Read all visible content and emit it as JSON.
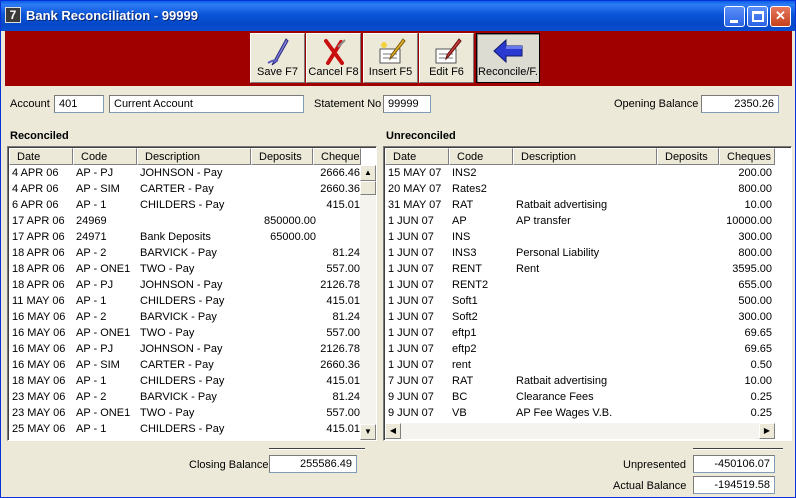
{
  "window": {
    "title": "Bank Reconciliation - 99999",
    "app_icon_text": "7",
    "accent_color": "#a00000"
  },
  "toolbar": {
    "save_label": "Save F7",
    "cancel_label": "Cancel F8",
    "insert_label": "Insert F5",
    "edit_label": "Edit F6",
    "reconcile_label": "Reconcile/F."
  },
  "header": {
    "account_label": "Account",
    "account_code": "401",
    "account_name": "Current Account",
    "statement_label": "Statement No",
    "statement_no": "99999",
    "opening_label": "Opening Balance",
    "opening_balance": "2350.26"
  },
  "reconciled": {
    "title": "Reconciled",
    "columns": [
      "Date",
      "Code",
      "Description",
      "Deposits",
      "Cheques"
    ],
    "rows": [
      [
        "4 APR 06",
        "AP - PJ",
        "JOHNSON - Pay",
        "",
        "2666.46"
      ],
      [
        "4 APR 06",
        "AP - SIM",
        "CARTER - Pay",
        "",
        "2660.36"
      ],
      [
        "6 APR 06",
        "AP - 1",
        "CHILDERS - Pay",
        "",
        "415.01"
      ],
      [
        "17 APR 06",
        "24969",
        "",
        "850000.00",
        ""
      ],
      [
        "17 APR 06",
        "24971",
        "Bank Deposits",
        "65000.00",
        ""
      ],
      [
        "18 APR 06",
        "AP - 2",
        "BARVICK - Pay",
        "",
        "81.24"
      ],
      [
        "18 APR 06",
        "AP - ONE1",
        "TWO - Pay",
        "",
        "557.00"
      ],
      [
        "18 APR 06",
        "AP - PJ",
        "JOHNSON - Pay",
        "",
        "2126.78"
      ],
      [
        "11 MAY 06",
        "AP - 1",
        "CHILDERS - Pay",
        "",
        "415.01"
      ],
      [
        "16 MAY 06",
        "AP - 2",
        "BARVICK - Pay",
        "",
        "81.24"
      ],
      [
        "16 MAY 06",
        "AP - ONE1",
        "TWO - Pay",
        "",
        "557.00"
      ],
      [
        "16 MAY 06",
        "AP - PJ",
        "JOHNSON - Pay",
        "",
        "2126.78"
      ],
      [
        "16 MAY 06",
        "AP - SIM",
        "CARTER - Pay",
        "",
        "2660.36"
      ],
      [
        "18 MAY 06",
        "AP - 1",
        "CHILDERS - Pay",
        "",
        "415.01"
      ],
      [
        "23 MAY 06",
        "AP - 2",
        "BARVICK - Pay",
        "",
        "81.24"
      ],
      [
        "23 MAY 06",
        "AP - ONE1",
        "TWO - Pay",
        "",
        "557.00"
      ],
      [
        "25 MAY 06",
        "AP - 1",
        "CHILDERS - Pay",
        "",
        "415.01"
      ]
    ],
    "closing_label": "Closing Balance",
    "closing_balance": "255586.49"
  },
  "unreconciled": {
    "title": "Unreconciled",
    "columns": [
      "Date",
      "Code",
      "Description",
      "Deposits",
      "Cheques"
    ],
    "rows": [
      [
        "15 MAY 07",
        "INS2",
        "",
        "",
        "200.00"
      ],
      [
        "20 MAY 07",
        "Rates2",
        "",
        "",
        "800.00"
      ],
      [
        "31 MAY 07",
        "RAT",
        "Ratbait advertising",
        "",
        "10.00"
      ],
      [
        "1 JUN 07",
        "AP",
        "AP transfer",
        "",
        "10000.00"
      ],
      [
        "1 JUN 07",
        "INS",
        "",
        "",
        "300.00"
      ],
      [
        "1 JUN 07",
        "INS3",
        "Personal Liability",
        "",
        "800.00"
      ],
      [
        "1 JUN 07",
        "RENT",
        "Rent",
        "",
        "3595.00"
      ],
      [
        "1 JUN 07",
        "RENT2",
        "",
        "",
        "655.00"
      ],
      [
        "1 JUN 07",
        "Soft1",
        "",
        "",
        "500.00"
      ],
      [
        "1 JUN 07",
        "Soft2",
        "",
        "",
        "300.00"
      ],
      [
        "1 JUN 07",
        "eftp1",
        "",
        "",
        "69.65"
      ],
      [
        "1 JUN 07",
        "eftp2",
        "",
        "",
        "69.65"
      ],
      [
        "1 JUN 07",
        "rent",
        "",
        "",
        "0.50"
      ],
      [
        "7 JUN 07",
        "RAT",
        "Ratbait advertising",
        "",
        "10.00"
      ],
      [
        "9 JUN 07",
        "BC",
        "Clearance Fees",
        "",
        "0.25"
      ],
      [
        "9 JUN 07",
        "VB",
        "AP Fee Wages V.B.",
        "",
        "0.25"
      ]
    ],
    "unpresented_label": "Unpresented",
    "unpresented": "-450106.07",
    "actual_label": "Actual Balance",
    "actual_balance": "-194519.58"
  }
}
